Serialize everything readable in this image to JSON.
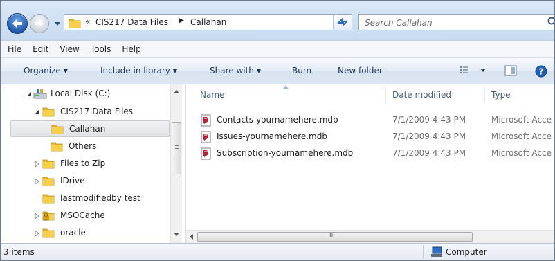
{
  "address": {
    "overflow_chevron": "«",
    "crumbs": [
      "CIS217 Data Files",
      "Callahan"
    ]
  },
  "search": {
    "placeholder": "Search Callahan"
  },
  "menu": [
    "File",
    "Edit",
    "View",
    "Tools",
    "Help"
  ],
  "toolbar": {
    "organize": "Organize",
    "include": "Include in library",
    "share": "Share with",
    "burn": "Burn",
    "new_folder": "New folder"
  },
  "nav": {
    "items": [
      {
        "label": "Local Disk (C:)",
        "icon": "drive-icon",
        "expanded": true
      },
      {
        "label": "CIS217 Data Files",
        "icon": "folder-icon",
        "expanded": true
      },
      {
        "label": "Callahan",
        "icon": "folder-icon",
        "selected": true
      },
      {
        "label": "Others",
        "icon": "folder-icon"
      },
      {
        "label": "Files to Zip",
        "icon": "folder-icon",
        "expandable": true
      },
      {
        "label": "IDrive",
        "icon": "folder-icon",
        "expandable": true
      },
      {
        "label": "lastmodifiedby test",
        "icon": "folder-icon"
      },
      {
        "label": "MSOCache",
        "icon": "locked-folder-icon",
        "expandable": true
      },
      {
        "label": "oracle",
        "icon": "folder-icon",
        "expandable": true
      }
    ]
  },
  "columns": {
    "name": "Name",
    "date": "Date modified",
    "type": "Type"
  },
  "files": [
    {
      "name": "Contacts-yournamehere.mdb",
      "date": "7/1/2009 4:43 PM",
      "type": "Microsoft Acce"
    },
    {
      "name": "Issues-yournamehere.mdb",
      "date": "7/1/2009 4:43 PM",
      "type": "Microsoft Acce"
    },
    {
      "name": "Subscription-yournamehere.mdb",
      "date": "7/1/2009 4:43 PM",
      "type": "Microsoft Acce"
    }
  ],
  "hscroll_glyph": "III",
  "status": {
    "count": "3 items",
    "location": "Computer"
  },
  "colors": {
    "folder": "#e8b923",
    "selection": "#e2e4e7",
    "accent": "#2357a8"
  }
}
